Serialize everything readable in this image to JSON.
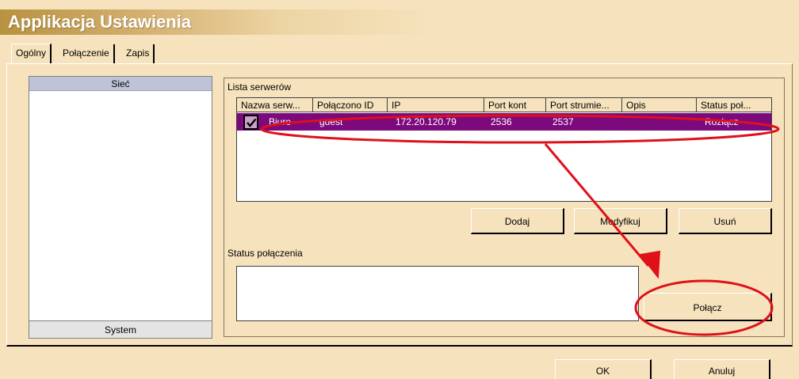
{
  "window": {
    "title": "Applikacja Ustawienia"
  },
  "tabs": [
    "Ogólny",
    "Połączenie",
    "Zapis"
  ],
  "left_panel": {
    "header": "Sieć",
    "footer": "System"
  },
  "server_group": {
    "label": "Lista serwerów",
    "columns": [
      "Nazwa serw...",
      "Połączono ID",
      "IP",
      "Port kont",
      "Port strumie...",
      "Opis",
      "Status poł..."
    ],
    "rows": [
      {
        "checked": true,
        "name": "Biuro",
        "login": "guest",
        "ip": "172.20.120.79",
        "port_control": "2536",
        "port_stream": "2537",
        "desc": "",
        "status": "Rozłącz"
      }
    ],
    "buttons": {
      "add": "Dodaj",
      "modify": "Modyfikuj",
      "remove": "Usuń"
    }
  },
  "status": {
    "label": "Status połączenia",
    "connect_button": "Połącz"
  },
  "footer_buttons": {
    "ok": "OK",
    "cancel": "Anuluj"
  },
  "colors": {
    "selection": "#7c0a7c",
    "background": "#f6e3bd",
    "annotation": "#e0101a"
  }
}
